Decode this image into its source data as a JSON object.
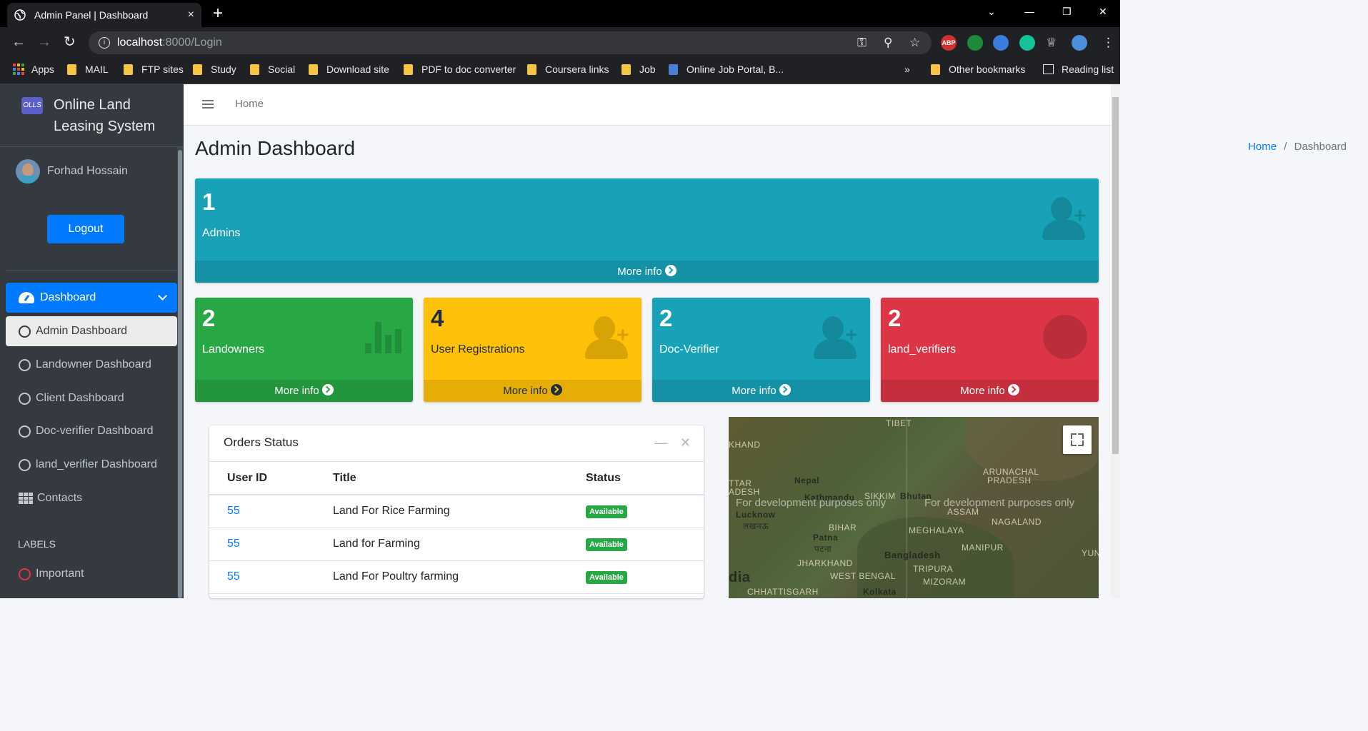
{
  "browser": {
    "tab_title": "Admin Panel | Dashboard",
    "tab_close": "×",
    "new_tab": "+",
    "url_host": "localhost",
    "url_path": ":8000/Login",
    "extensions": [
      "ABP"
    ]
  },
  "bookmarks": [
    {
      "label": "Apps"
    },
    {
      "label": "MAIL"
    },
    {
      "label": "FTP sites"
    },
    {
      "label": "Study"
    },
    {
      "label": "Social"
    },
    {
      "label": "Download site"
    },
    {
      "label": "PDF to doc converter"
    },
    {
      "label": "Coursera links"
    },
    {
      "label": "Job"
    },
    {
      "label": "Online Job Portal, B..."
    },
    {
      "label": "»"
    },
    {
      "label": "Other bookmarks"
    },
    {
      "label": "Reading list"
    }
  ],
  "sidebar": {
    "brand_logo": "OLLS",
    "brand_line1": "Online Land",
    "brand_line2": "Leasing System",
    "user_name": "Forhad Hossain",
    "logout_label": "Logout",
    "menu_dashboard": "Dashboard",
    "items": [
      {
        "label": "Admin Dashboard"
      },
      {
        "label": "Landowner Dashboard"
      },
      {
        "label": "Client Dashboard"
      },
      {
        "label": "Doc-verifier Dashboard"
      },
      {
        "label": "land_verifier Dashboard"
      }
    ],
    "contacts": "Contacts",
    "labels_header": "LABELS",
    "important": "Important"
  },
  "topnav": {
    "home": "Home"
  },
  "page": {
    "title": "Admin Dashboard",
    "breadcrumb_home": "Home",
    "breadcrumb_sep": "/",
    "breadcrumb_current": "Dashboard"
  },
  "boxes": {
    "admins": {
      "count": "1",
      "label": "Admins",
      "more": "More info",
      "color": "#17a2b8"
    },
    "landowners": {
      "count": "2",
      "label": "Landowners",
      "more": "More info",
      "color": "#28a745"
    },
    "user_registrations": {
      "count": "4",
      "label": "User Registrations",
      "more": "More info",
      "color": "#ffc107"
    },
    "doc_verifier": {
      "count": "2",
      "label": "Doc-Verifier",
      "more": "More info",
      "color": "#17a2b8"
    },
    "land_verifiers": {
      "count": "2",
      "label": "land_verifiers",
      "more": "More info",
      "color": "#dc3545"
    }
  },
  "orders": {
    "title": "Orders Status",
    "columns": [
      "User ID",
      "Title",
      "Status"
    ],
    "rows": [
      {
        "user_id": "55",
        "title": "Land For Rice Farming",
        "status": "Available"
      },
      {
        "user_id": "55",
        "title": "Land for Farming",
        "status": "Available"
      },
      {
        "user_id": "55",
        "title": "Land For Poultry farming",
        "status": "Available"
      }
    ]
  },
  "map": {
    "watermark": "For development purposes only",
    "labels": [
      "TIBET",
      "KHAND",
      "Nepal",
      "Kathmandu",
      "SIKKIM",
      "Bhutan",
      "ARUNACHAL",
      "PRADESH",
      "TTAR",
      "ADESH",
      "Lucknow",
      "लखनऊ",
      "BIHAR",
      "Patna",
      "पटना",
      "MEGHALAYA",
      "ASSAM",
      "NAGALAND",
      "Bangladesh",
      "MANIPUR",
      "JHARKHAND",
      "TRIPURA",
      "WEST BENGAL",
      "MIZORAM",
      "dia",
      "CHHATTISGARH",
      "Kolkata",
      "YUN"
    ]
  }
}
